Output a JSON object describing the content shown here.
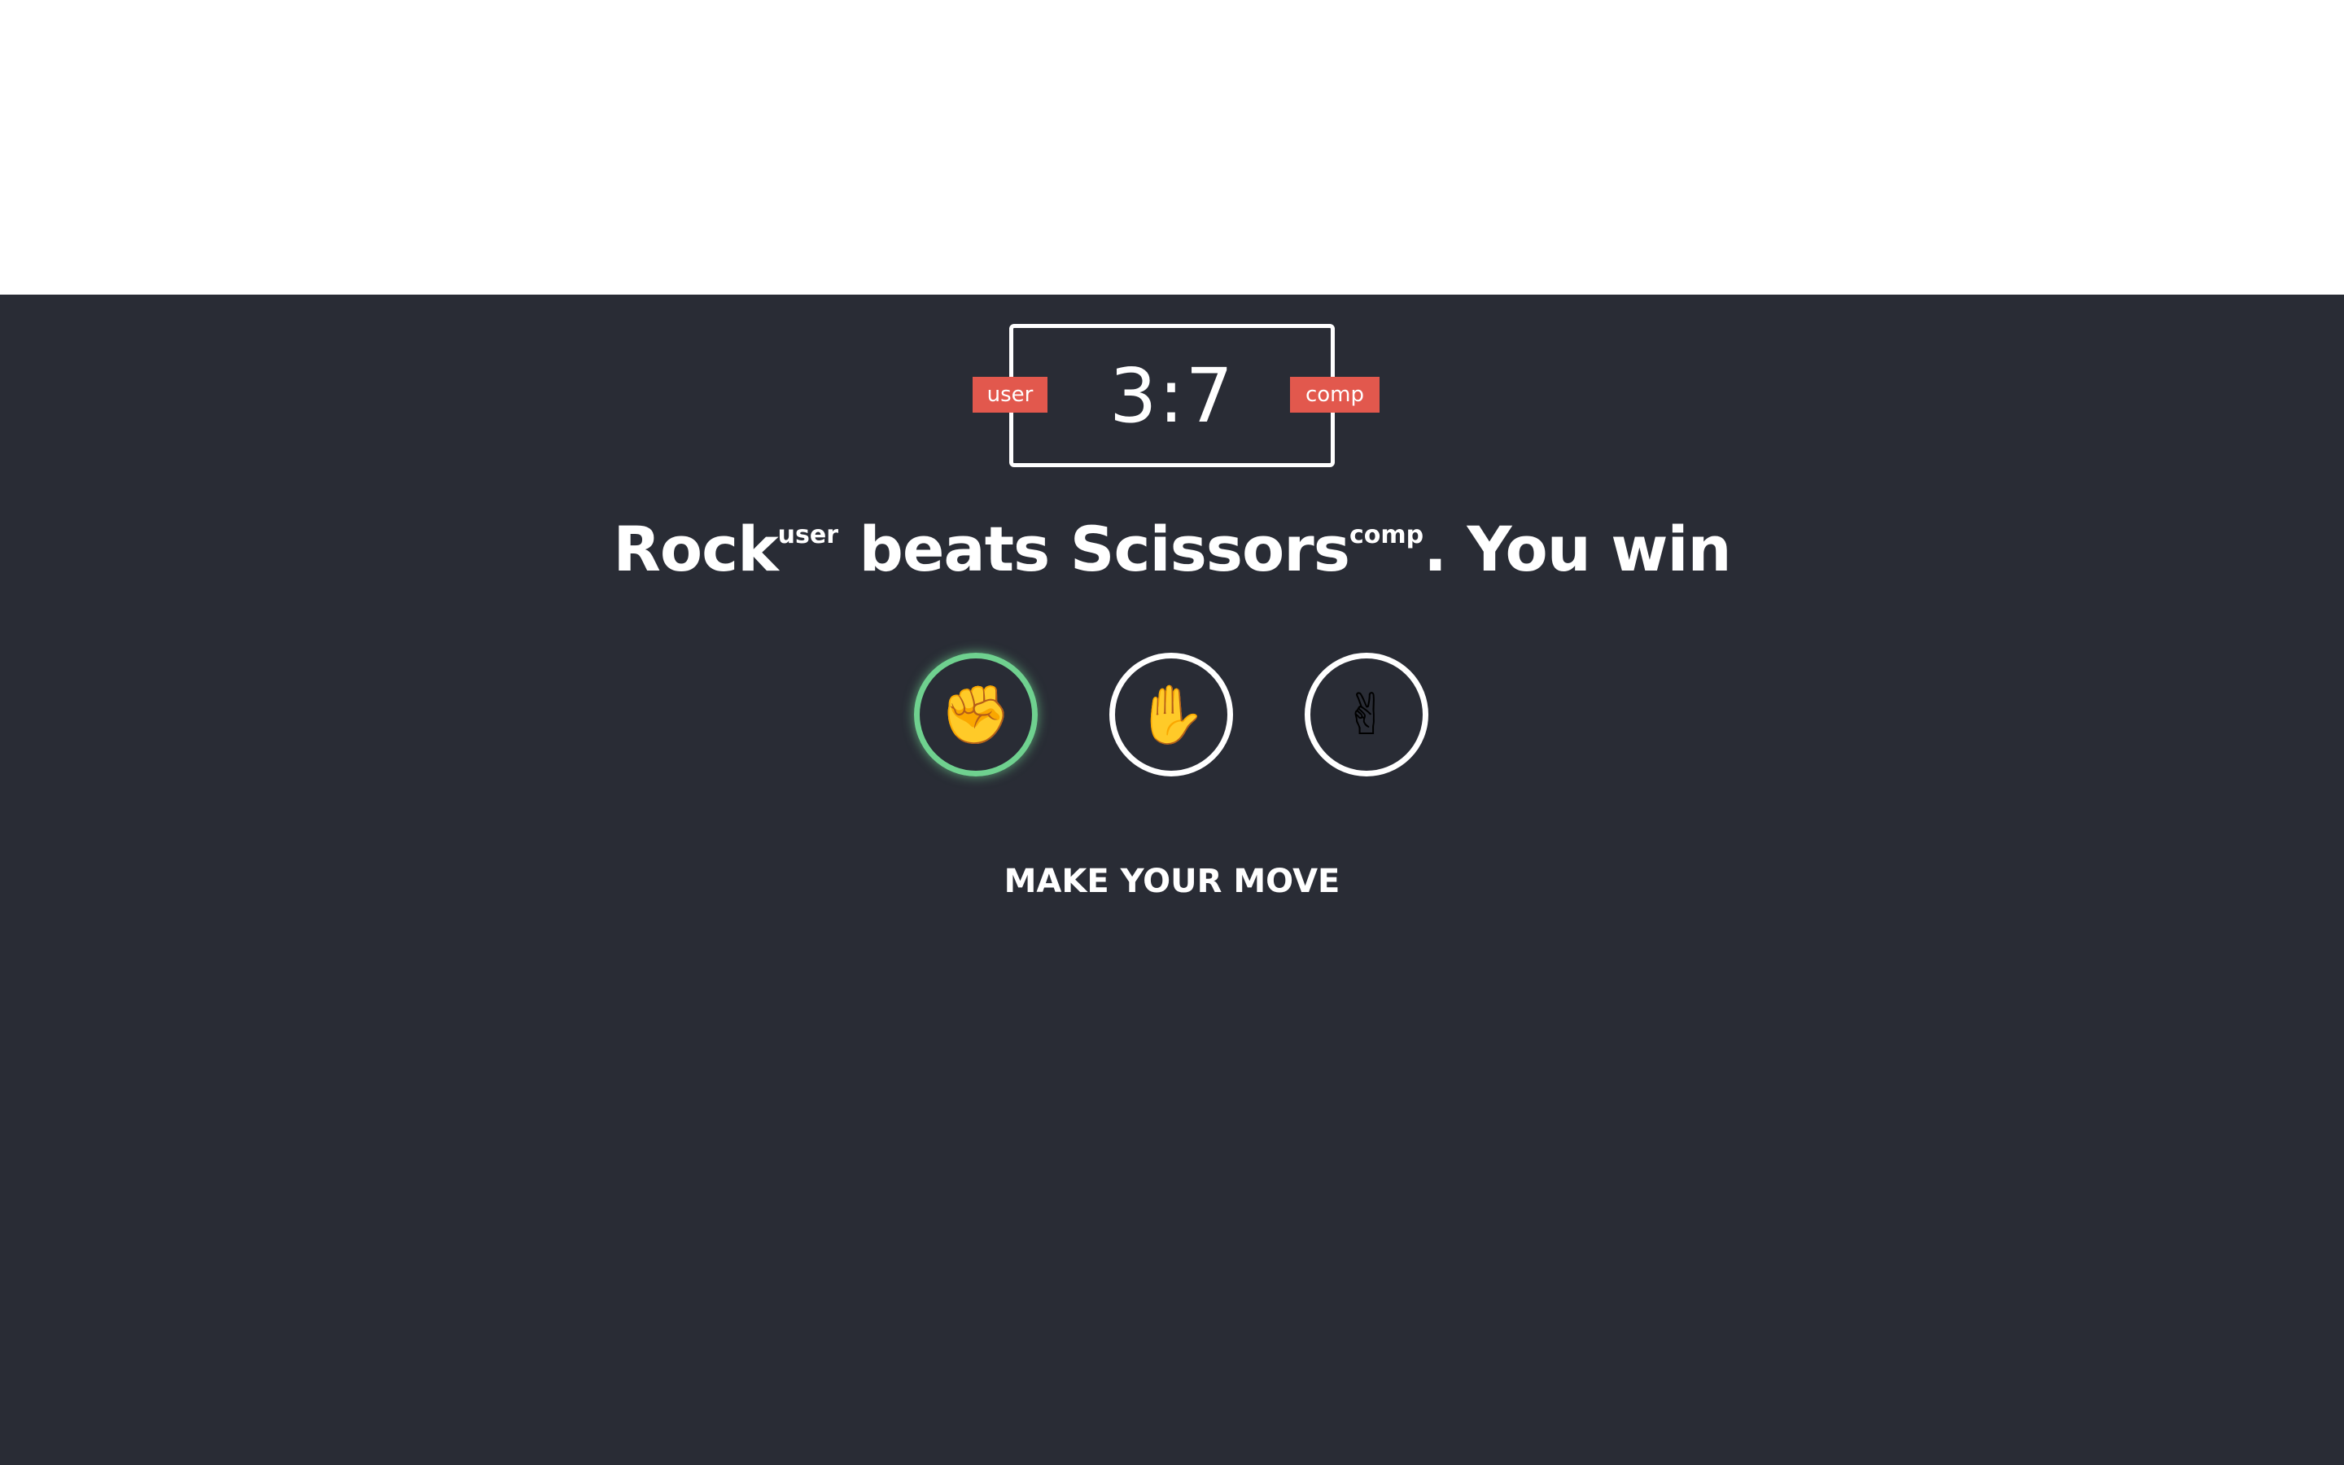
{
  "score": {
    "display": "3:7",
    "user_label": "user",
    "comp_label": "comp"
  },
  "result": {
    "user_choice": "Rock",
    "user_tag": "user",
    "verb": " beats ",
    "comp_choice": "Scissors",
    "comp_tag": "comp",
    "outcome": ". You win"
  },
  "choices": [
    {
      "name": "rock",
      "icon": "✊",
      "selected": true
    },
    {
      "name": "paper",
      "icon": "✋",
      "selected": false
    },
    {
      "name": "scissors",
      "icon": "✌",
      "selected": false
    }
  ],
  "prompt": "MAKE YOUR MOVE",
  "colors": {
    "background": "#292c35",
    "badge": "#e2584d",
    "win_highlight": "#6fd18f",
    "text": "#ffffff"
  }
}
